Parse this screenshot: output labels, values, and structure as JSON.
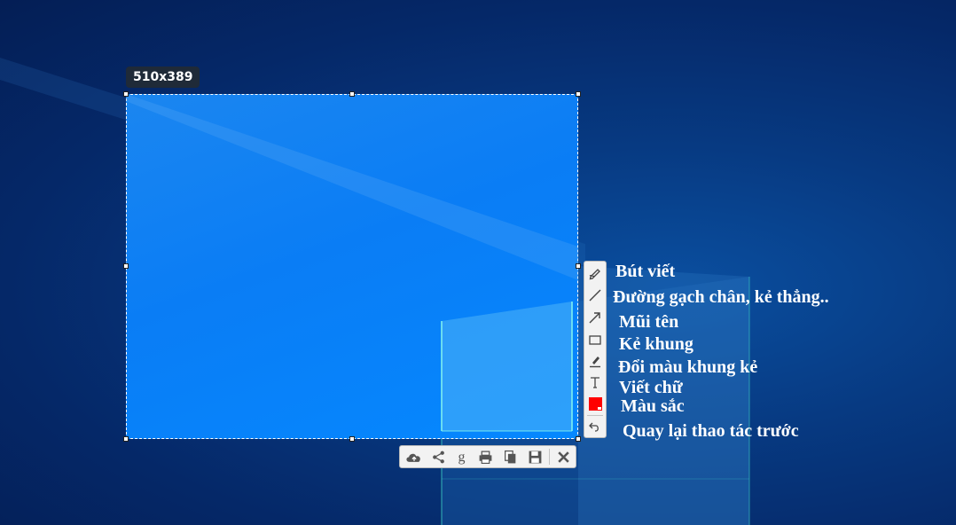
{
  "capture": {
    "dimensions_label": "510x389"
  },
  "side_toolbar": {
    "tools": [
      {
        "name": "pencil-icon"
      },
      {
        "name": "line-icon"
      },
      {
        "name": "arrow-icon"
      },
      {
        "name": "rectangle-icon"
      },
      {
        "name": "marker-icon"
      },
      {
        "name": "text-icon"
      },
      {
        "name": "color-swatch",
        "color": "#ff0000"
      },
      {
        "name": "undo-icon"
      }
    ]
  },
  "bottom_toolbar": {
    "tools": [
      "upload-cloud-icon",
      "share-icon",
      "google-search-icon",
      "print-icon",
      "copy-icon",
      "save-icon",
      "close-icon"
    ]
  },
  "annotations": {
    "pen": "Bút viết",
    "line": "Đường gạch chân, kẻ thẳng..",
    "arrow": "Mũi tên",
    "frame": "Kẻ khung",
    "frame_color": "Đổi màu khung kẻ",
    "text": "Viết chữ",
    "color": "Màu sắc",
    "undo": "Quay lại thao tác trước"
  },
  "colors": {
    "desktop_bg": "#063276",
    "selection_bg": "#0a7df5",
    "annotation_text": "#ffffff",
    "swatch": "#ff0000"
  }
}
